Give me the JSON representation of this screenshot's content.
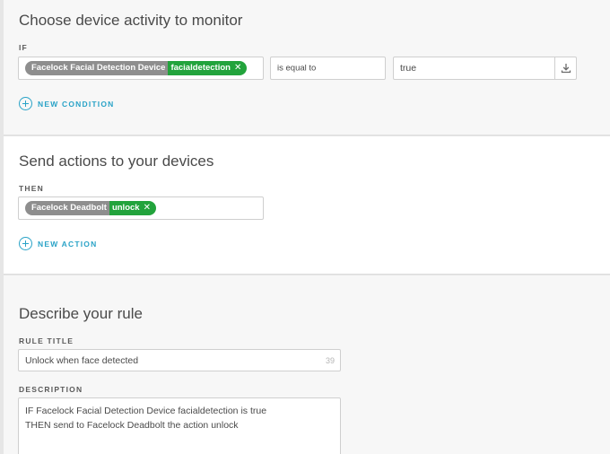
{
  "condition_section": {
    "heading": "Choose device activity to monitor",
    "if_label": "IF",
    "device_name": "Facelock Facial Detection Device",
    "attribute": "facialdetection",
    "operator": "is equal to",
    "value": "true",
    "add_label": "NEW CONDITION"
  },
  "action_section": {
    "heading": "Send actions to your devices",
    "then_label": "THEN",
    "device_name": "Facelock Deadbolt",
    "action": "unlock",
    "add_label": "NEW ACTION"
  },
  "rule_section": {
    "heading": "Describe your rule",
    "title_label": "RULE TITLE",
    "title_value": "Unlock when face detected",
    "char_count": "39",
    "description_label": "DESCRIPTION",
    "description_lines": [
      "IF Facelock Facial Detection Device facialdetection is true",
      "THEN send to Facelock Deadbolt the action unlock"
    ]
  },
  "colors": {
    "accent": "#2aa3c7",
    "chip_green": "#22a33c",
    "chip_gray": "#8e8e8e"
  },
  "icons": {
    "remove": "x-icon",
    "add": "plus-circle-icon",
    "download": "download-icon"
  }
}
